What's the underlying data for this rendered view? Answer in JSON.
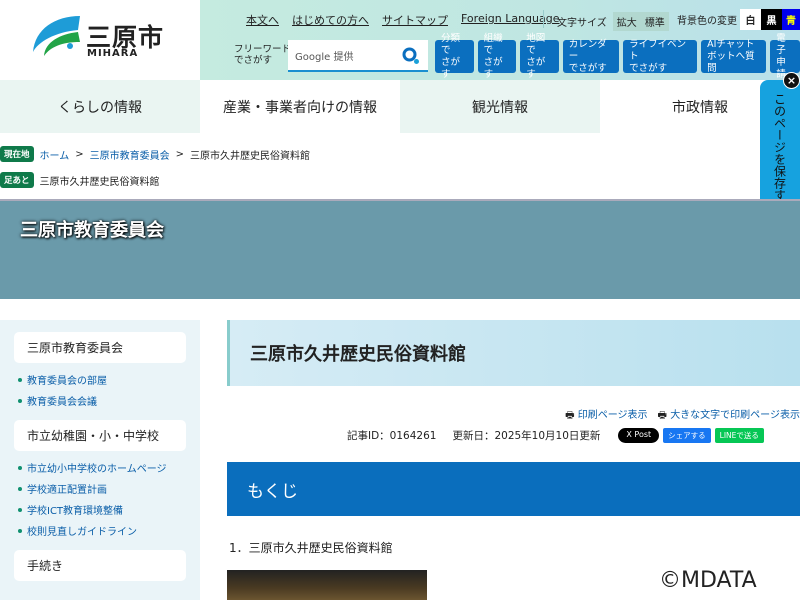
{
  "logo": {
    "name": "三原市",
    "romaji": "MIHARA"
  },
  "toplinks": [
    "本文へ",
    "はじめての方へ",
    "サイトマップ",
    "Foreign Language"
  ],
  "font_size": {
    "label": "文字サイズ",
    "enlarge": "拡大",
    "standard": "標準"
  },
  "bg_color": {
    "label": "背景色の変更",
    "white": "白",
    "black": "黒",
    "blue": "青"
  },
  "search": {
    "label_1": "フリーワード",
    "label_2": "でさがす",
    "placeholder": "Google 提供"
  },
  "nav_buttons": [
    [
      "分類で",
      "さがす"
    ],
    [
      "組織で",
      "さがす"
    ],
    [
      "地図で",
      "さがす"
    ],
    [
      "カレンダー",
      "でさがす"
    ],
    [
      "ライフイベント",
      "でさがす"
    ],
    [
      "AIチャット",
      "ボットへ質問"
    ],
    [
      "電子",
      "申請"
    ]
  ],
  "global_nav": [
    "くらしの情報",
    "産業・事業者向けの情報",
    "観光情報",
    "市政情報"
  ],
  "save_page": "このページを保存する",
  "breadcrumb": {
    "tag": "現在地",
    "items": [
      "ホーム",
      "三原市教育委員会"
    ],
    "current": "三原市久井歴史民俗資料館"
  },
  "footprint": {
    "tag": "足あと",
    "current": "三原市久井歴史民俗資料館"
  },
  "banner_title": "三原市教育委員会",
  "sidebar": [
    {
      "heading": "三原市教育委員会",
      "links": [
        "教育委員会の部屋",
        "教育委員会会議"
      ]
    },
    {
      "heading": "市立幼稚園・小・中学校",
      "links": [
        "市立幼小中学校のホームページ",
        "学校適正配置計画",
        "学校ICT教育環境整備",
        "校則見直しガイドライン"
      ]
    },
    {
      "heading": "手続き",
      "links": []
    }
  ],
  "article": {
    "title": "三原市久井歴史民俗資料館",
    "print": "印刷ページ表示",
    "print_large": "大きな文字で印刷ページ表示",
    "id": "記事ID：0164261",
    "updated": "更新日：2025年10月10日更新",
    "share": {
      "x": "X Post",
      "fb": "シェアする",
      "line": "LINEで送る"
    },
    "toc": "もくじ",
    "section1": "1．三原市久井歴史民俗資料館"
  },
  "watermark": "©MDATA"
}
